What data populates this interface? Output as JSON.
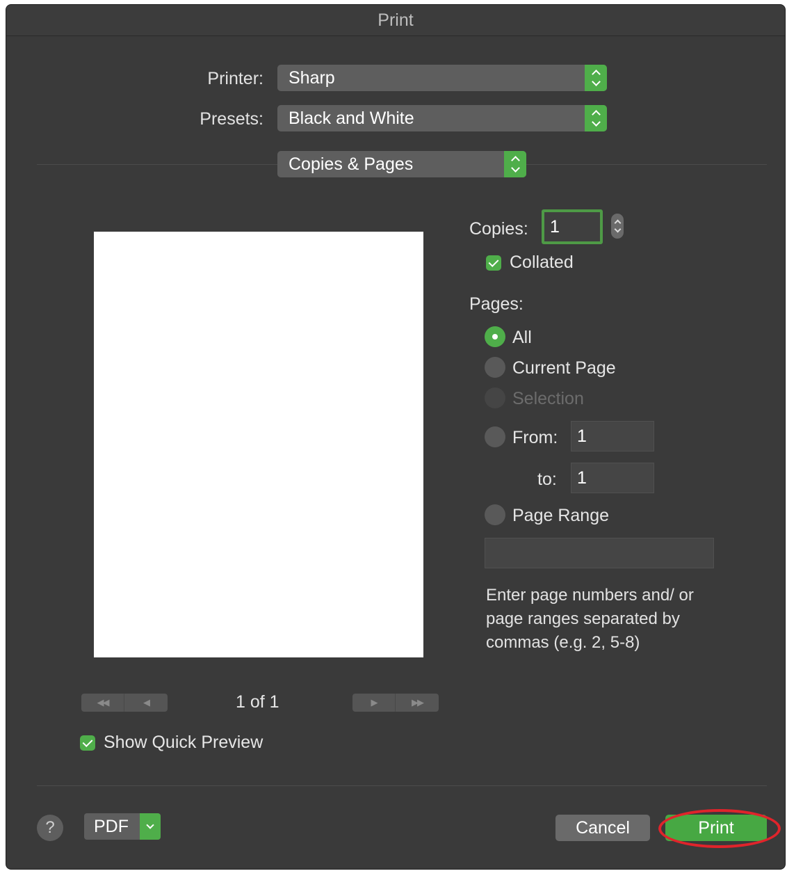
{
  "window": {
    "title": "Print"
  },
  "printer": {
    "label": "Printer:",
    "value": "Sharp"
  },
  "presets": {
    "label": "Presets:",
    "value": "Black and White"
  },
  "section": {
    "value": "Copies & Pages"
  },
  "preview": {
    "page_info": "1 of 1"
  },
  "copies": {
    "label": "Copies:",
    "value": "1",
    "collated_label": "Collated",
    "collated_checked": true
  },
  "pages": {
    "label": "Pages:",
    "options": [
      {
        "label": "All",
        "selected": true,
        "enabled": true
      },
      {
        "label": "Current Page",
        "selected": false,
        "enabled": true
      },
      {
        "label": "Selection",
        "selected": false,
        "enabled": false
      },
      {
        "label": "From:",
        "selected": false,
        "enabled": true
      },
      {
        "label": "Page Range",
        "selected": false,
        "enabled": true
      }
    ],
    "from_value": "1",
    "to_label": "to:",
    "to_value": "1",
    "range_value": "",
    "help_text": "Enter page numbers and/ or page ranges separated by commas (e.g. 2, 5-8)"
  },
  "quick_preview": {
    "label": "Show Quick Preview",
    "checked": true
  },
  "footer": {
    "help_label": "?",
    "pdf_label": "PDF",
    "cancel_label": "Cancel",
    "print_label": "Print"
  },
  "colors": {
    "accent": "#4fae4a",
    "highlight": "#e0242b",
    "background": "#3a3a3a"
  }
}
